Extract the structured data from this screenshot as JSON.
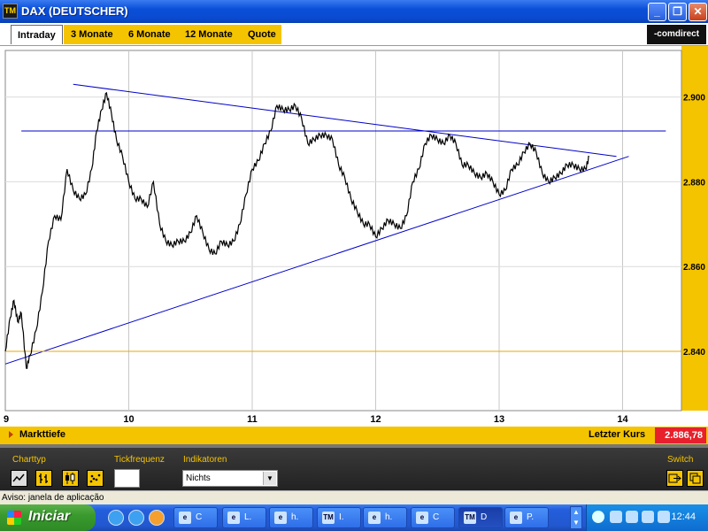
{
  "window": {
    "title": "DAX (DEUTSCHER)",
    "icon_text": "TM",
    "buttons": [
      "minimize",
      "restore",
      "close"
    ]
  },
  "tabs": [
    {
      "label": "Intraday",
      "active": true
    },
    {
      "label": "3 Monate",
      "active": false
    },
    {
      "label": "6 Monate",
      "active": false
    },
    {
      "label": "12 Monate",
      "active": false
    },
    {
      "label": "Quote",
      "active": false
    }
  ],
  "logo": "-comdirect",
  "chart_data": {
    "type": "line",
    "title": "",
    "xlabel": "",
    "ylabel": "",
    "x_ticks": [
      "9",
      "10",
      "11",
      "12",
      "13",
      "14"
    ],
    "y_ticks": [
      "2.840",
      "2.860",
      "2.880",
      "2.900"
    ],
    "xlim": [
      9,
      14.5
    ],
    "ylim": [
      2826,
      2911
    ],
    "grid": true,
    "series": [
      {
        "color": "#000000",
        "x": [
          9.0,
          9.04,
          9.07,
          9.1,
          9.13,
          9.17,
          9.2,
          9.25,
          9.3,
          9.35,
          9.4,
          9.45,
          9.5,
          9.55,
          9.6,
          9.65,
          9.7,
          9.74,
          9.78,
          9.82,
          9.86,
          9.9,
          9.95,
          10.0,
          10.05,
          10.1,
          10.15,
          10.2,
          10.25,
          10.3,
          10.35,
          10.4,
          10.45,
          10.5,
          10.55,
          10.6,
          10.65,
          10.7,
          10.75,
          10.8,
          10.85,
          10.9,
          10.95,
          11.0,
          11.05,
          11.1,
          11.15,
          11.2,
          11.25,
          11.3,
          11.35,
          11.4,
          11.45,
          11.5,
          11.55,
          11.6,
          11.65,
          11.7,
          11.75,
          11.8,
          11.85,
          11.9,
          11.95,
          12.0,
          12.05,
          12.1,
          12.15,
          12.2,
          12.25,
          12.3,
          12.35,
          12.4,
          12.45,
          12.5,
          12.55,
          12.6,
          12.65,
          12.7,
          12.75,
          12.8,
          12.85,
          12.9,
          12.95,
          13.0,
          13.05,
          13.1,
          13.15,
          13.2,
          13.25,
          13.3,
          13.35,
          13.4,
          13.45,
          13.5,
          13.55,
          13.6,
          13.65,
          13.7,
          13.73
        ],
        "values": [
          2840,
          2848,
          2852,
          2847,
          2849,
          2836,
          2839,
          2845,
          2854,
          2866,
          2872,
          2871,
          2883,
          2878,
          2876,
          2877,
          2883,
          2892,
          2897,
          2901,
          2896,
          2890,
          2886,
          2880,
          2876,
          2876,
          2874,
          2880,
          2870,
          2866,
          2865,
          2866,
          2866,
          2868,
          2872,
          2868,
          2864,
          2863,
          2866,
          2865,
          2866,
          2870,
          2877,
          2883,
          2885,
          2889,
          2892,
          2898,
          2897,
          2897,
          2898,
          2895,
          2889,
          2890,
          2891,
          2891,
          2890,
          2884,
          2881,
          2876,
          2873,
          2870,
          2870,
          2867,
          2869,
          2871,
          2870,
          2869,
          2872,
          2880,
          2883,
          2889,
          2891,
          2890,
          2889,
          2891,
          2889,
          2884,
          2884,
          2882,
          2881,
          2882,
          2880,
          2877,
          2878,
          2883,
          2884,
          2887,
          2889,
          2887,
          2882,
          2880,
          2881,
          2882,
          2884,
          2884,
          2883,
          2883,
          2886
        ]
      }
    ],
    "lines": [
      {
        "name": "resistance",
        "color": "#0000c8",
        "from": [
          9.55,
          2903
        ],
        "to": [
          13.95,
          2886
        ]
      },
      {
        "name": "support",
        "color": "#0000c8",
        "from": [
          9.0,
          2837
        ],
        "to": [
          14.05,
          2886
        ]
      },
      {
        "name": "horizontal-resistance",
        "color": "#0000c8",
        "from": [
          9.13,
          2892
        ],
        "to": [
          14.35,
          2892
        ]
      },
      {
        "name": "horizontal-support",
        "color": "#e8a800",
        "from": [
          9.0,
          2840
        ],
        "to": [
          14.48,
          2840
        ]
      }
    ]
  },
  "markttiefe": {
    "label": "Markttiefe"
  },
  "letzter_kurs": {
    "label": "Letzter Kurs",
    "value": "2.886,78"
  },
  "toolbar": {
    "charttyp_label": "Charttyp",
    "tickfrequenz_label": "Tickfrequenz",
    "indikatoren_label": "Indikatoren",
    "indikatoren_value": "Nichts",
    "switch_label": "Switch"
  },
  "status": {
    "text": "Aviso: janela de aplicação"
  },
  "taskbar": {
    "start_label": "Iniciar",
    "tasks": [
      {
        "icon": "e",
        "label": "C"
      },
      {
        "icon": "e",
        "label": "L."
      },
      {
        "icon": "e",
        "label": "h."
      },
      {
        "icon": "TM",
        "label": "I."
      },
      {
        "icon": "e",
        "label": "h."
      },
      {
        "icon": "e",
        "label": "C"
      },
      {
        "icon": "TM",
        "label": "D"
      },
      {
        "icon": "e",
        "label": "P."
      }
    ],
    "clock": "12:44"
  }
}
